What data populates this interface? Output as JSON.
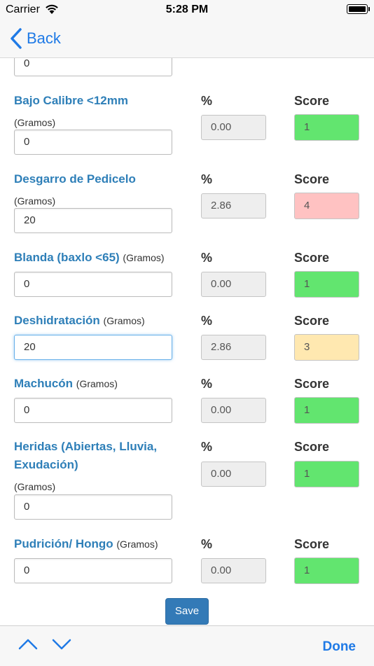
{
  "status": {
    "carrier": "Carrier",
    "time": "5:28 PM"
  },
  "nav": {
    "back_label": "Back"
  },
  "colors": {
    "green": "#62e56f",
    "red": "#ffc2c2",
    "yellow": "#ffe8b0",
    "accent": "#1f7ae6",
    "label_blue": "#2e7fb8"
  },
  "top_partial_value": "0",
  "headers": {
    "percent": "%",
    "score": "Score"
  },
  "rows": [
    {
      "label": "Bajo Calibre <12mm",
      "unit": "(Gramos)",
      "value": "0",
      "percent": "0.00",
      "score": "1",
      "score_color": "green"
    },
    {
      "label": "Desgarro de Pedicelo",
      "unit": "(Gramos)",
      "value": "20",
      "percent": "2.86",
      "score": "4",
      "score_color": "red"
    },
    {
      "label": "Blanda (baxlo <65)",
      "unit": "(Gramos)",
      "value": "0",
      "percent": "0.00",
      "score": "1",
      "score_color": "green"
    },
    {
      "label": "Deshidratación",
      "unit": "(Gramos)",
      "value": "20",
      "percent": "2.86",
      "score": "3",
      "score_color": "yellow"
    },
    {
      "label": "Machucón",
      "unit": "(Gramos)",
      "value": "0",
      "percent": "0.00",
      "score": "1",
      "score_color": "green"
    },
    {
      "label_line1": "Heridas (Abiertas, Lluvia,",
      "label_line2": "Exudación)",
      "unit": "(Gramos)",
      "value": "0",
      "percent": "0.00",
      "score": "1",
      "score_color": "green"
    },
    {
      "label": "Pudrición/ Hongo",
      "unit": "(Gramos)",
      "value": "0",
      "percent": "0.00",
      "score": "1",
      "score_color": "green"
    }
  ],
  "save_label": "Save",
  "toolbar": {
    "done_label": "Done"
  }
}
